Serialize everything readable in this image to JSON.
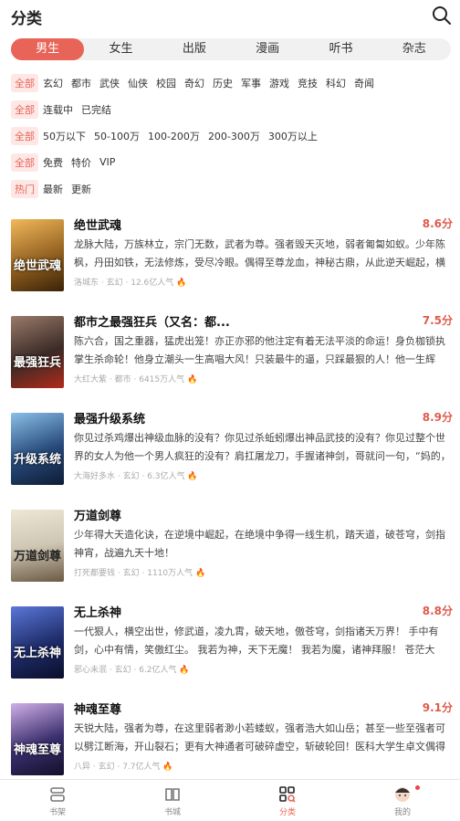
{
  "header": {
    "title": "分类"
  },
  "tabs": [
    {
      "label": "男生",
      "active": true
    },
    {
      "label": "女生"
    },
    {
      "label": "出版"
    },
    {
      "label": "漫画"
    },
    {
      "label": "听书"
    },
    {
      "label": "杂志"
    }
  ],
  "filters": {
    "category": [
      "全部",
      "玄幻",
      "都市",
      "武侠",
      "仙侠",
      "校园",
      "奇幻",
      "历史",
      "军事",
      "游戏",
      "竞技",
      "科幻",
      "奇闻"
    ],
    "status": [
      "全部",
      "连载中",
      "已完结"
    ],
    "length": [
      "全部",
      "50万以下",
      "50-100万",
      "100-200万",
      "200-300万",
      "300万以上"
    ],
    "price": [
      "全部",
      "免费",
      "特价",
      "VIP"
    ],
    "sort": [
      "热门",
      "最新",
      "更新"
    ]
  },
  "books": [
    {
      "title": "绝世武魂",
      "score": "8.6分",
      "desc": "龙脉大陆，万族林立，宗门无数，武者为尊。强者毁天灭地，弱者匍匐如蚁。少年陈枫，丹田如铁，无法修炼，受尽冷眼。偶得至尊龙血，神秘古鼎，从此逆天崛起，横空出世！娇...",
      "author": "洛城东",
      "genre": "玄幻",
      "pop": "12.6亿人气",
      "cover_text": "绝世武魂",
      "cover_bg": "#8a5a1c"
    },
    {
      "title": "都市之最强狂兵（又名：都...",
      "score": "7.5分",
      "desc": "陈六合，国之重器，猛虎出笼！亦正亦邪的他注定有着无法平淡的命运！身负枷锁执掌生杀命轮！他身立潮头一生高唱大风！只装最牛的逼，只踩最狠的人！他一生辉煌，彪悍铸就...",
      "author": "大红大紫",
      "genre": "都市",
      "pop": "6415万人气",
      "cover_text": "最强狂兵",
      "cover_bg": "#3a2a26"
    },
    {
      "title": "最强升级系统",
      "score": "8.9分",
      "desc": "你见过杀鸡爆出神级血脉的没有？你见过杀蚯蚓爆出神品武技的没有？你见过整个世界的女人为他一个男人疯狂的没有？肩扛屠龙刀，手握诸神剑，哥就问一句，“妈的，还有谁...",
      "author": "大海好多水",
      "genre": "玄幻",
      "pop": "6.3亿人气",
      "cover_text": "升级系统",
      "cover_bg": "#274a7a"
    },
    {
      "title": "万道剑尊",
      "score": "",
      "desc": "少年得大天造化诀，在逆境中崛起，在绝境中争得一线生机，踏天道，破苍穹，剑指神宵，战遍九天十地！",
      "author": "打死都要钱",
      "genre": "玄幻",
      "pop": "1110万人气",
      "cover_text": "万道剑尊",
      "cover_bg": "#cfc7b4"
    },
    {
      "title": "无上杀神",
      "score": "8.8分",
      "desc": "一代狠人，横空出世，修武道，凌九霄，破天地，傲苍穹，剑指诸天万界！ 手中有剑，心中有情，笑傲红尘。 我若为神，天下无魔！ 我若为魔，诸神拜服！ 苍茫大地，纵纷万...",
      "author": "邪心未泯",
      "genre": "玄幻",
      "pop": "6.2亿人气",
      "cover_text": "无上杀神",
      "cover_bg": "#1f2c6a"
    },
    {
      "title": "神魂至尊",
      "score": "9.1分",
      "desc": "天锐大陆，强者为尊，在这里弱者渺小若蝼蚁，强者浩大如山岳；甚至一些至强者可以劈江断海，开山裂石；更有大神通者可破碎虚空，斩破轮回！医科大学生卓文偶得玉鼎穿越到...",
      "author": "八异",
      "genre": "玄幻",
      "pop": "7.7亿人气",
      "cover_text": "神魂至尊",
      "cover_bg": "#3b2f6e"
    }
  ],
  "bottom_nav": [
    {
      "label": "书架",
      "icon": "bookshelf-icon"
    },
    {
      "label": "书城",
      "icon": "book-icon"
    },
    {
      "label": "分类",
      "icon": "category-icon",
      "active": true
    },
    {
      "label": "我的",
      "icon": "avatar-icon"
    }
  ],
  "colors": {
    "accent": "#e86458",
    "score": "#e05a4c",
    "chip_bg": "#fde8e6"
  }
}
